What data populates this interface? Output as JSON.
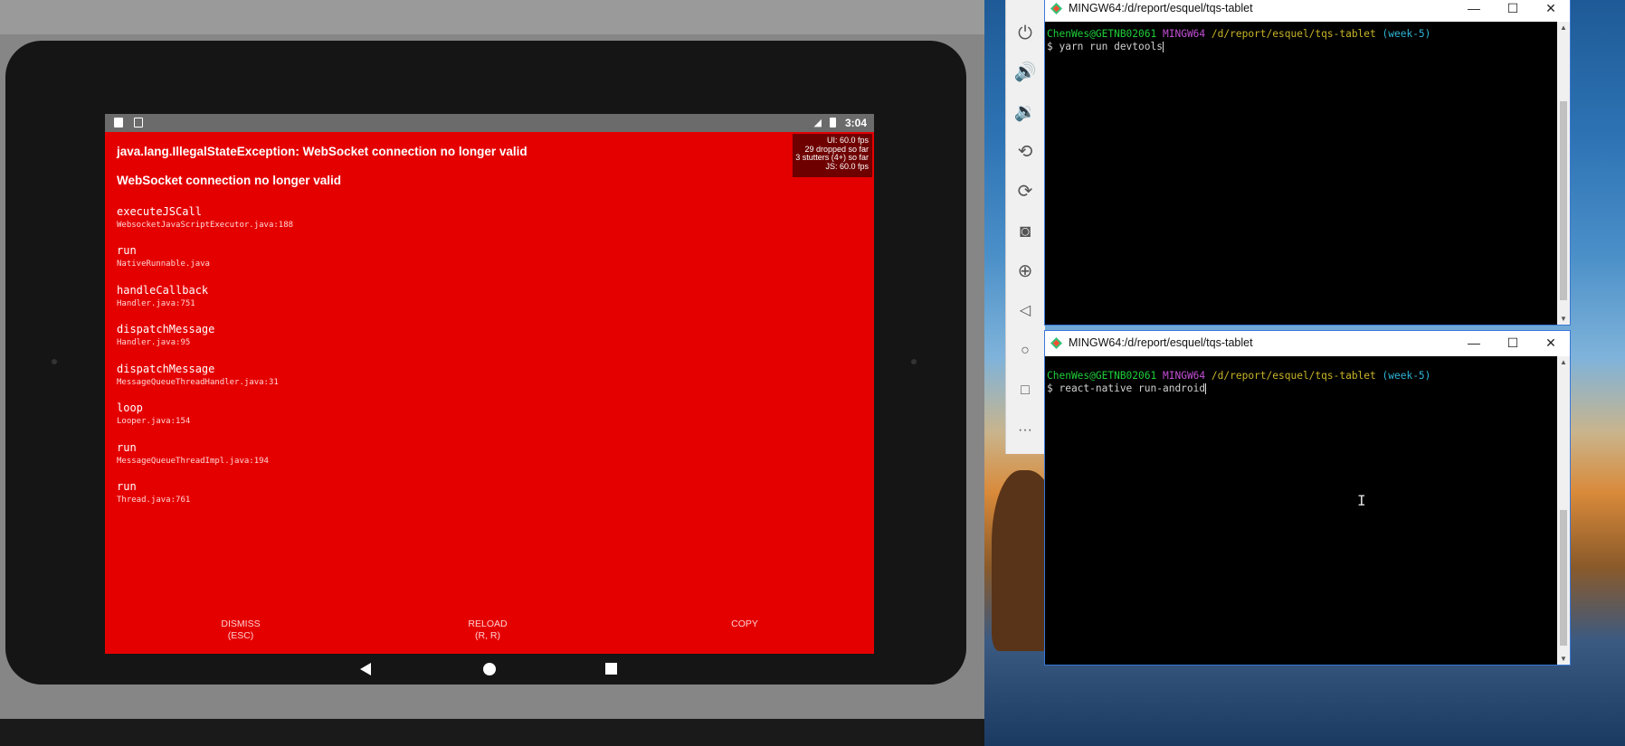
{
  "tablet": {
    "statusbar": {
      "time": "3:04"
    },
    "redbox": {
      "title": "java.lang.IllegalStateException: WebSocket connection no longer valid",
      "message": "WebSocket connection no longer valid",
      "perf": [
        "UI: 60.0 fps",
        "29 dropped so far",
        "3 stutters (4+) so far",
        "JS: 60.0 fps"
      ],
      "stack": [
        {
          "method": "executeJSCall",
          "location": "WebsocketJavaScriptExecutor.java:188"
        },
        {
          "method": "run",
          "location": "NativeRunnable.java"
        },
        {
          "method": "handleCallback",
          "location": "Handler.java:751"
        },
        {
          "method": "dispatchMessage",
          "location": "Handler.java:95"
        },
        {
          "method": "dispatchMessage",
          "location": "MessageQueueThreadHandler.java:31"
        },
        {
          "method": "loop",
          "location": "Looper.java:154"
        },
        {
          "method": "run",
          "location": "MessageQueueThreadImpl.java:194"
        },
        {
          "method": "run",
          "location": "Thread.java:761"
        }
      ],
      "buttons": {
        "dismiss": {
          "label": "DISMISS",
          "shortcut": "(ESC)"
        },
        "reload": {
          "label": "RELOAD",
          "shortcut": "(R, R)"
        },
        "copy": {
          "label": "COPY"
        }
      }
    }
  },
  "emulator_toolbar": {
    "icons": [
      "power-icon",
      "volume-up-icon",
      "volume-down-icon",
      "rotate-left-icon",
      "rotate-right-icon",
      "camera-icon",
      "zoom-icon",
      "back-icon",
      "home-icon",
      "overview-icon",
      "more-icon"
    ]
  },
  "terminal1": {
    "title": "MINGW64:/d/report/esquel/tqs-tablet",
    "prompt_user": "ChenWes@GETNB02061",
    "prompt_env": "MINGW64",
    "prompt_path": "/d/report/esquel/tqs-tablet",
    "prompt_branch": "(week-5)",
    "command": "$ yarn run devtools"
  },
  "terminal2": {
    "title": "MINGW64:/d/report/esquel/tqs-tablet",
    "prompt_user": "ChenWes@GETNB02061",
    "prompt_env": "MINGW64",
    "prompt_path": "/d/report/esquel/tqs-tablet",
    "prompt_branch": "(week-5)",
    "command": "$ react-native run-android"
  },
  "window_controls": {
    "minimize": "—",
    "maximize": "☐",
    "close": "✕"
  },
  "colors": {
    "redbox": "#e50000",
    "prompt_user": "#1fd03a",
    "prompt_env": "#c34fd6",
    "prompt_path": "#c8b428",
    "prompt_branch": "#2fb6d8"
  }
}
